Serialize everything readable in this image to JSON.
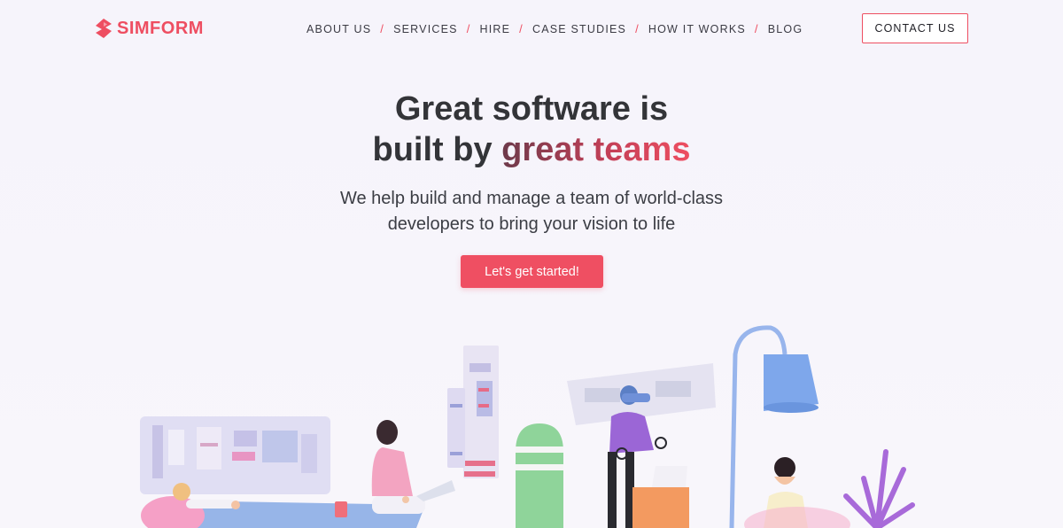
{
  "brand": {
    "name": "SIMFORM",
    "logo_icon": "simform-logo-icon",
    "accent_color": "#ee4e61"
  },
  "nav": {
    "items": [
      {
        "label": "ABOUT US"
      },
      {
        "label": "SERVICES"
      },
      {
        "label": "HIRE"
      },
      {
        "label": "CASE STUDIES"
      },
      {
        "label": "HOW IT WORKS"
      },
      {
        "label": "BLOG"
      }
    ],
    "separator": "/",
    "contact_label": "CONTACT US"
  },
  "hero": {
    "title_line1": "Great software is",
    "title_line2_prefix": "built by ",
    "title_line2_accent": "great teams",
    "subtitle_line1": "We help build and manage a team of world-class",
    "subtitle_line2": "developers to bring your vision to life",
    "cta_label": "Let's get started!",
    "cta_color": "#ef4f62"
  },
  "illustration": {
    "icon": "team-workspace-illustration"
  }
}
